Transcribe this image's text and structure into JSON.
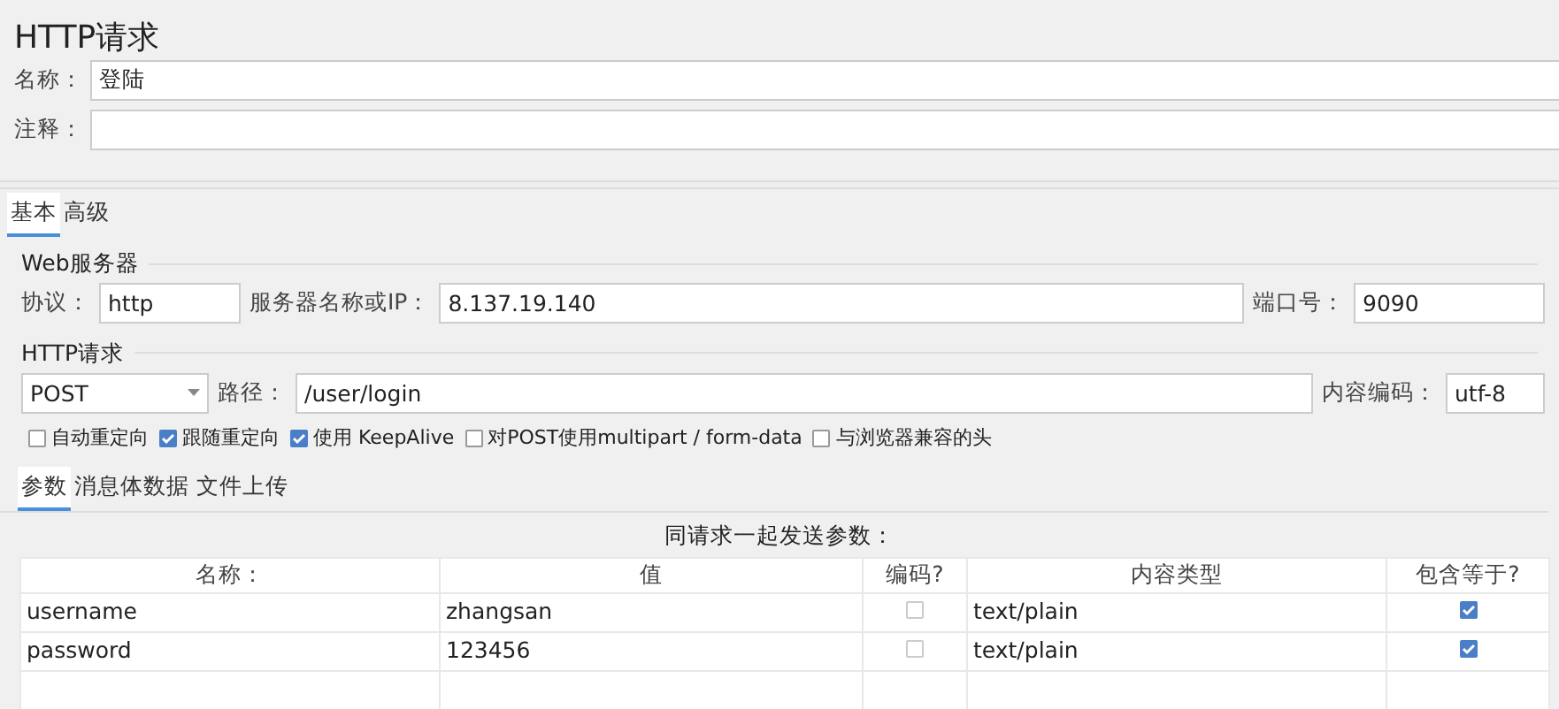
{
  "title": "HTTP请求",
  "fields": [
    {
      "label": "名称：",
      "value": "登陆"
    },
    {
      "label": "注释："
    }
  ],
  "tabs": [
    {
      "label": "基本",
      "selected": true
    },
    {
      "label": "高级",
      "selected": false
    }
  ],
  "web_server": {
    "legend": "Web服务器",
    "protocol_label": "协议：",
    "protocol": "http",
    "server_label": "服务器名称或IP：",
    "server": "8.137.19.140",
    "port_label": "端口号：",
    "port": "9090"
  },
  "http_request": {
    "legend": "HTTP请求",
    "method": "POST",
    "path_label": "路径：",
    "path": "/user/login",
    "encoding_label": "内容编码：",
    "encoding": "utf-8"
  },
  "options": [
    {
      "label": "自动重定向",
      "checked": false
    },
    {
      "label": "跟随重定向",
      "checked": true
    },
    {
      "label": "使用 KeepAlive",
      "checked": true
    },
    {
      "label": "对POST使用multipart / form-data",
      "checked": false
    },
    {
      "label": "与浏览器兼容的头",
      "checked": false
    }
  ],
  "sub_tabs": [
    {
      "label": "参数",
      "selected": true
    },
    {
      "label": "消息体数据",
      "selected": false
    },
    {
      "label": "文件上传",
      "selected": false
    }
  ],
  "table": {
    "caption": "同请求一起发送参数：",
    "columns": [
      "名称：",
      "值",
      "编码?",
      "内容类型",
      "包含等于?"
    ],
    "rows": [
      {
        "name": "username",
        "value": "zhangsan",
        "encode": false,
        "content_type": "text/plain",
        "include_equals": true
      },
      {
        "name": "password",
        "value": "123456",
        "encode": false,
        "content_type": "text/plain",
        "include_equals": true
      }
    ]
  }
}
